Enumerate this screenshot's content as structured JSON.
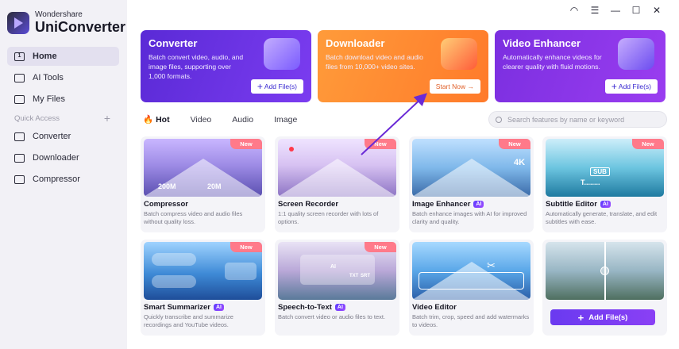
{
  "app": {
    "brand_small": "Wondershare",
    "brand_big": "UniConverter"
  },
  "window_controls": [
    {
      "name": "headset-icon",
      "glyph": "🎧"
    },
    {
      "name": "menu-icon",
      "glyph": "☰"
    },
    {
      "name": "minimize-icon",
      "glyph": "—"
    },
    {
      "name": "maximize-icon",
      "glyph": "☐"
    },
    {
      "name": "close-icon",
      "glyph": "✕"
    }
  ],
  "sidebar": {
    "items": [
      {
        "label": "Home",
        "icon": "home-icon",
        "active": true
      },
      {
        "label": "AI Tools",
        "icon": "ai-tools-icon"
      },
      {
        "label": "My Files",
        "icon": "files-icon"
      }
    ],
    "quick_access_label": "Quick Access",
    "quick_items": [
      {
        "label": "Converter",
        "icon": "converter-icon"
      },
      {
        "label": "Downloader",
        "icon": "downloader-icon"
      },
      {
        "label": "Compressor",
        "icon": "compressor-icon"
      }
    ]
  },
  "hero": {
    "converter": {
      "title": "Converter",
      "desc": "Batch convert video, audio, and image files, supporting over 1,000 formats.",
      "button": "Add File(s)"
    },
    "downloader": {
      "title": "Downloader",
      "desc": "Batch download video and audio files from 10,000+ video sites.",
      "button": "Start Now"
    },
    "enhancer": {
      "title": "Video Enhancer",
      "desc": "Automatically enhance videos for clearer quality with fluid motions.",
      "button": "Add File(s)"
    }
  },
  "tabs": [
    "Hot",
    "Video",
    "Audio",
    "Image"
  ],
  "search": {
    "placeholder": "Search features by name or keyword"
  },
  "new_badge": "New",
  "ai_badge": "AI",
  "cards": {
    "compressor": {
      "title": "Compressor",
      "desc": "Batch compress video and audio files without quality loss.",
      "size_from": "200M",
      "size_to": "20M"
    },
    "recorder": {
      "title": "Screen Recorder",
      "desc": "1:1 quality screen recorder with lots of options."
    },
    "image_enhancer": {
      "title": "Image Enhancer",
      "desc": "Batch enhance images with AI for improved clarity and quality.",
      "res": "4K"
    },
    "subtitle": {
      "title": "Subtitle Editor",
      "desc": "Automatically generate, translate, and edit subtitles with ease.",
      "sub": "SUB",
      "text": "T........"
    },
    "summarizer": {
      "title": "Smart Summarizer",
      "desc": "Quickly transcribe and summarize recordings and YouTube videos."
    },
    "stt": {
      "title": "Speech-to-Text",
      "desc": "Batch convert video or audio files to text.",
      "ai_tag": "AI",
      "txt": "TXT",
      "srt": "SRT"
    },
    "video_editor": {
      "title": "Video Editor",
      "desc": "Batch trim, crop, speed and add watermarks to videos."
    },
    "watermark": {
      "button": "Add File(s)"
    }
  }
}
